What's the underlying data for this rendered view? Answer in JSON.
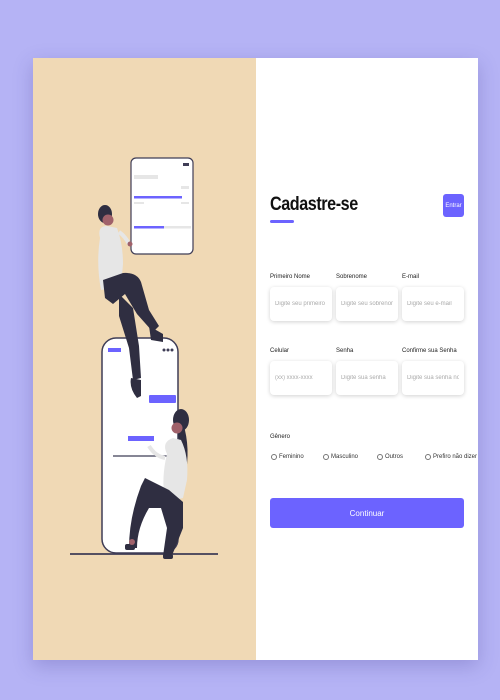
{
  "header": {
    "title": "Cadastre-se",
    "login_label": "Entrar"
  },
  "form": {
    "fields": [
      {
        "label": "Primeiro Nome",
        "placeholder": "Digite seu primeiro nome"
      },
      {
        "label": "Sobrenome",
        "placeholder": "Digite seu sobrenome"
      },
      {
        "label": "E-mail",
        "placeholder": "Digite seu e-mail"
      },
      {
        "label": "Celular",
        "placeholder": "(xx) xxxx-xxxx"
      },
      {
        "label": "Senha",
        "placeholder": "Digite sua senha"
      },
      {
        "label": "Confirme sua Senha",
        "placeholder": "Digite sua senha novamente"
      }
    ],
    "gender": {
      "title": "Gênero",
      "options": [
        "Feminino",
        "Masculino",
        "Outros",
        "Prefiro não dizer"
      ]
    },
    "submit_label": "Continuar"
  },
  "colors": {
    "background": "#b5b3f5",
    "accent": "#6c63ff",
    "illustration_panel": "#f0d9b5"
  }
}
